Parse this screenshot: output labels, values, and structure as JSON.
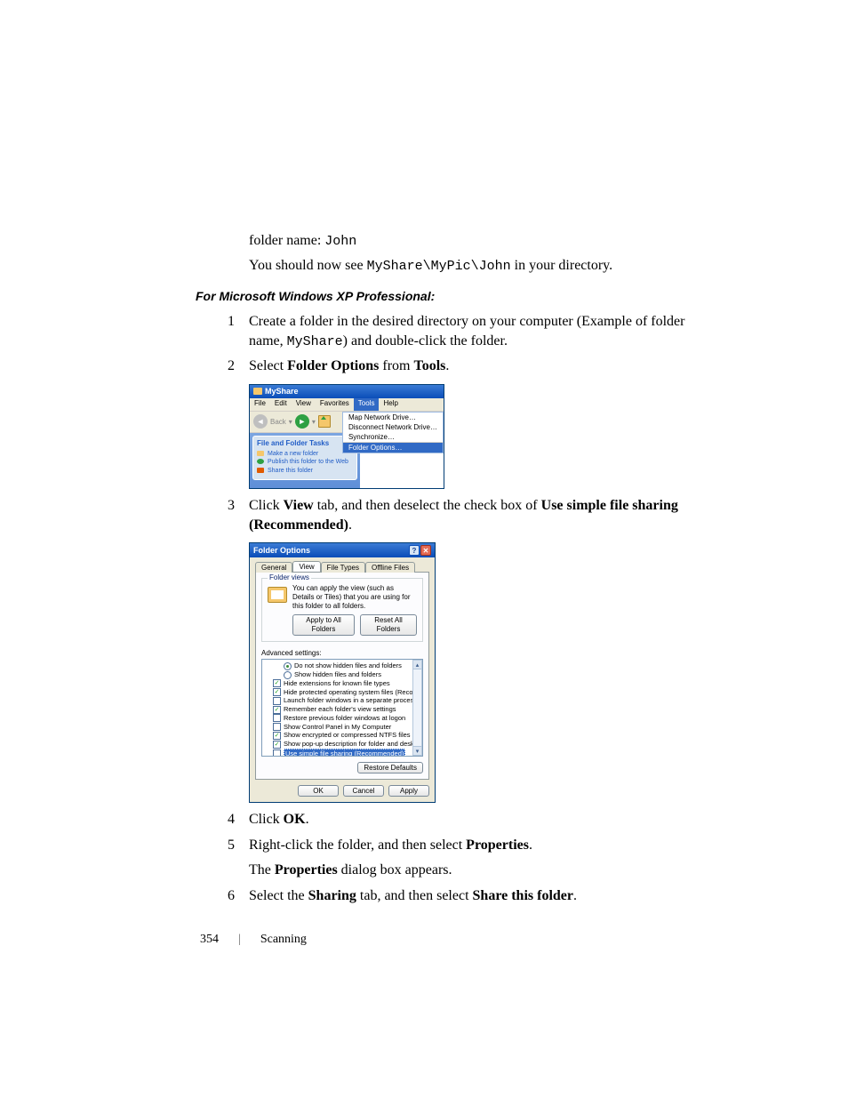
{
  "intro": {
    "line1_prefix": "folder name: ",
    "line1_code": "John",
    "line2_a": "You should now see ",
    "line2_code": "MyShare\\MyPic\\John",
    "line2_b": " in your directory."
  },
  "section_heading": "For Microsoft Windows XP Professional:",
  "steps": {
    "s1": {
      "num": "1",
      "text_a": "Create a folder in the desired directory on your computer (Example of folder name, ",
      "code": "MyShare",
      "text_b": ") and double-click the folder."
    },
    "s2": {
      "num": "2",
      "text_a": "Select ",
      "bold_a": "Folder Options",
      "text_b": " from ",
      "bold_b": "Tools",
      "text_c": "."
    },
    "s3": {
      "num": "3",
      "text_a": "Click ",
      "bold_a": "View",
      "text_b": " tab, and then deselect the check box of ",
      "bold_b": "Use simple file sharing (Recommended)",
      "text_c": "."
    },
    "s4": {
      "num": "4",
      "text_a": "Click ",
      "bold_a": "OK",
      "text_b": "."
    },
    "s5": {
      "num": "5",
      "text_a": "Right-click the folder, and then select ",
      "bold_a": "Properties",
      "text_b": ".",
      "sub_a": "The ",
      "sub_bold": "Properties",
      "sub_b": " dialog box appears."
    },
    "s6": {
      "num": "6",
      "text_a": "Select the ",
      "bold_a": "Sharing",
      "text_b": " tab, and then select ",
      "bold_b": "Share this folder",
      "text_c": "."
    }
  },
  "shot1": {
    "title": "MyShare",
    "menubar": {
      "file": "File",
      "edit": "Edit",
      "view": "View",
      "favorites": "Favorites",
      "tools": "Tools",
      "help": "Help"
    },
    "back_label": "Back",
    "dropdown": {
      "map": "Map Network Drive…",
      "disconnect": "Disconnect Network Drive…",
      "sync": "Synchronize…",
      "folder_options": "Folder Options…"
    },
    "side": {
      "title": "File and Folder Tasks",
      "make": "Make a new folder",
      "publish": "Publish this folder to the Web",
      "share": "Share this folder"
    }
  },
  "shot2": {
    "title": "Folder Options",
    "help_glyph": "?",
    "close_glyph": "✕",
    "tabs": {
      "general": "General",
      "view": "View",
      "filetypes": "File Types",
      "offline": "Offline Files"
    },
    "folder_views": {
      "legend": "Folder views",
      "desc": "You can apply the view (such as Details or Tiles) that you are using for this folder to all folders.",
      "apply_all": "Apply to All Folders",
      "reset_all": "Reset All Folders"
    },
    "advanced_label": "Advanced settings:",
    "advanced": {
      "radio_hide": "Do not show hidden files and folders",
      "radio_show": "Show hidden files and folders",
      "hide_ext": "Hide extensions for known file types",
      "hide_os": "Hide protected operating system files (Recommended)",
      "launch_sep": "Launch folder windows in a separate process",
      "remember": "Remember each folder's view settings",
      "restore_logon": "Restore previous folder windows at logon",
      "ctrl_panel": "Show Control Panel in My Computer",
      "ntfs_color": "Show encrypted or compressed NTFS files in color",
      "popup_desc": "Show pop-up description for folder and desktop items",
      "simple_sharing": "Use simple file sharing (Recommended)"
    },
    "restore_defaults": "Restore Defaults",
    "buttons": {
      "ok": "OK",
      "cancel": "Cancel",
      "apply": "Apply"
    }
  },
  "footer": {
    "page": "354",
    "chapter": "Scanning"
  }
}
